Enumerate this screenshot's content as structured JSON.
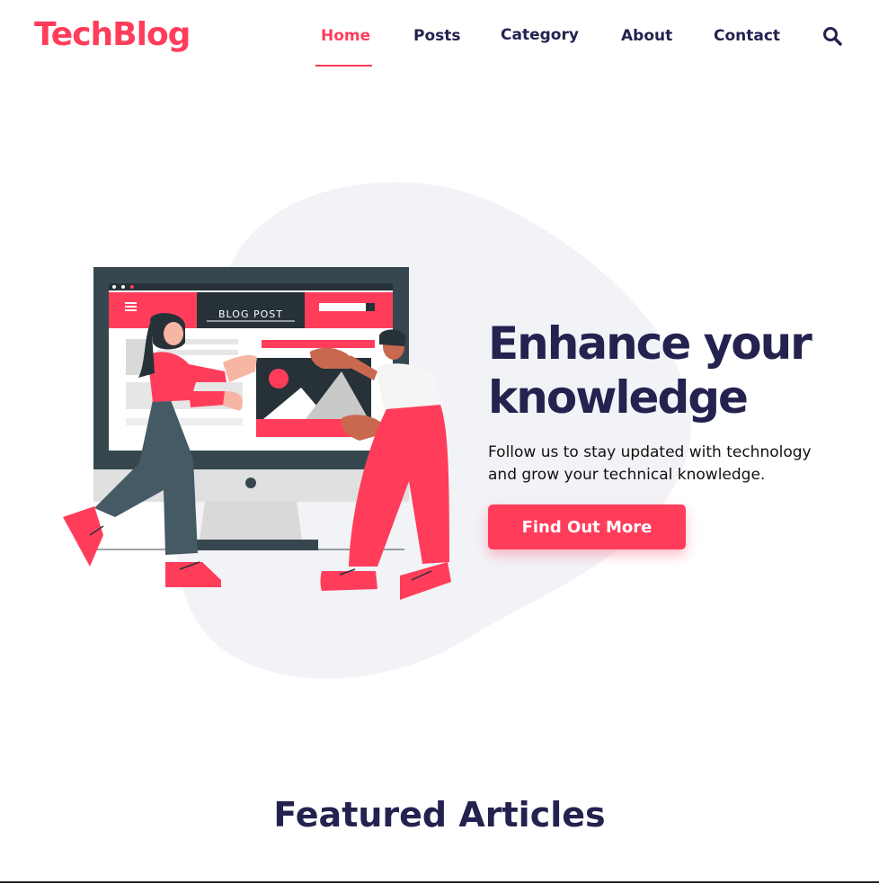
{
  "brand": {
    "name": "TechBlog",
    "color": "#ff3d5b"
  },
  "nav": {
    "items": [
      {
        "label": "Home",
        "active": true
      },
      {
        "label": "Posts",
        "active": false
      },
      {
        "label": "Category",
        "active": false
      },
      {
        "label": "About",
        "active": false
      },
      {
        "label": "Contact",
        "active": false
      }
    ],
    "search_icon": "search-icon"
  },
  "hero": {
    "title_line1": "Enhance your",
    "title_line2": "knowledge",
    "subtitle": "Follow us to stay updated with technology and grow your technical knowledge.",
    "cta_label": "Find Out More",
    "illustration": {
      "screen_label": "BLOG POST"
    }
  },
  "featured": {
    "title": "Featured Articles"
  },
  "colors": {
    "accent": "#ff3d5b",
    "text": "#24224f",
    "blob": "#f2f3f7"
  }
}
